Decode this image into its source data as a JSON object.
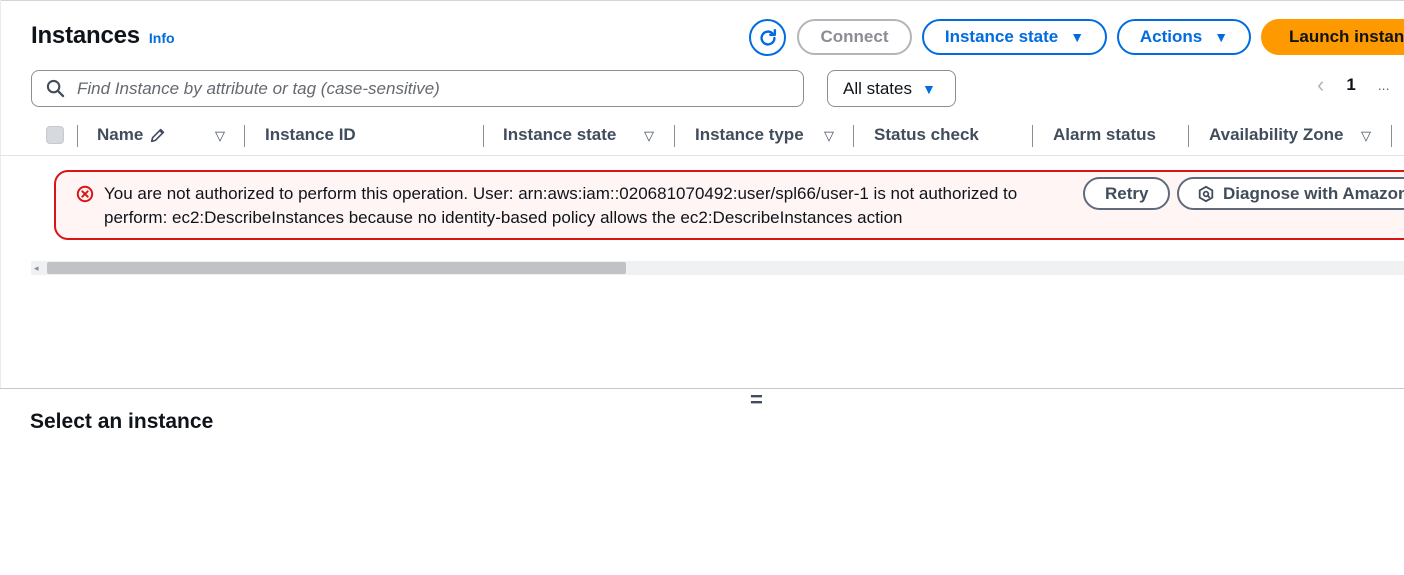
{
  "header": {
    "title": "Instances",
    "info_label": "Info"
  },
  "toolbar": {
    "refresh_icon": "refresh-icon",
    "connect_label": "Connect",
    "instance_state_label": "Instance state",
    "actions_label": "Actions",
    "launch_label": "Launch instances"
  },
  "filter": {
    "search_placeholder": "Find Instance by attribute or tag (case-sensitive)",
    "state_select_value": "All states"
  },
  "pagination": {
    "current_page": "1",
    "more": "..."
  },
  "table": {
    "columns": [
      "Name",
      "Instance ID",
      "Instance state",
      "Instance type",
      "Status check",
      "Alarm status",
      "Availability Zone"
    ]
  },
  "error": {
    "message": "You are not authorized to perform this operation. User: arn:aws:iam::020681070492:user/spl66/user-1 is not authorized to perform: ec2:DescribeInstances because no identity-based policy allows the ec2:DescribeInstances action",
    "retry_label": "Retry",
    "diagnose_label": "Diagnose with Amazon Q"
  },
  "details": {
    "title": "Select an instance"
  },
  "colors": {
    "accent": "#006ce0",
    "primary_button": "#ff9900",
    "error": "#d91515"
  }
}
